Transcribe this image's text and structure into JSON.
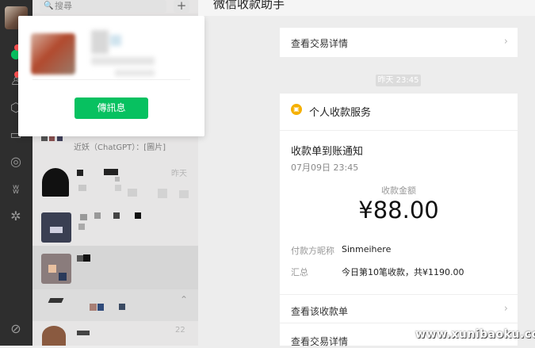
{
  "search": {
    "placeholder": "搜尋"
  },
  "toolbar": {
    "add_label": "+"
  },
  "popup": {
    "send_label": "傳訊息"
  },
  "chat_list": {
    "preview_snippet": "近妖（ChatGPT）：[圖片]",
    "time_1": "昨天",
    "time_2": "22"
  },
  "chat": {
    "title": "微信收款助手",
    "top_link": "查看交易详情",
    "timestamp": "昨天 23:45",
    "service_name": "个人收款服务",
    "notice_title": "收款单到账通知",
    "notice_time": "07月09日 23:45",
    "amount_label": "收款金额",
    "amount": "¥88.00",
    "payer_label": "付款方昵称",
    "payer_value": "Sinmeihere",
    "summary_label": "汇总",
    "summary_value": "今日第10笔收款，共¥1190.00",
    "link_view_order": "查看该收款单",
    "link_view_detail": "查看交易详情"
  },
  "watermark": "www.xunibaoku.com",
  "colors": {
    "accent": "#07c160",
    "rail": "#2e2e2e",
    "badge": "#fa5151"
  },
  "icons": [
    "chat-icon",
    "contacts-icon",
    "cube-icon",
    "folder-icon",
    "aperture-icon",
    "butterfly-icon",
    "sparkle-icon",
    "link-icon"
  ]
}
